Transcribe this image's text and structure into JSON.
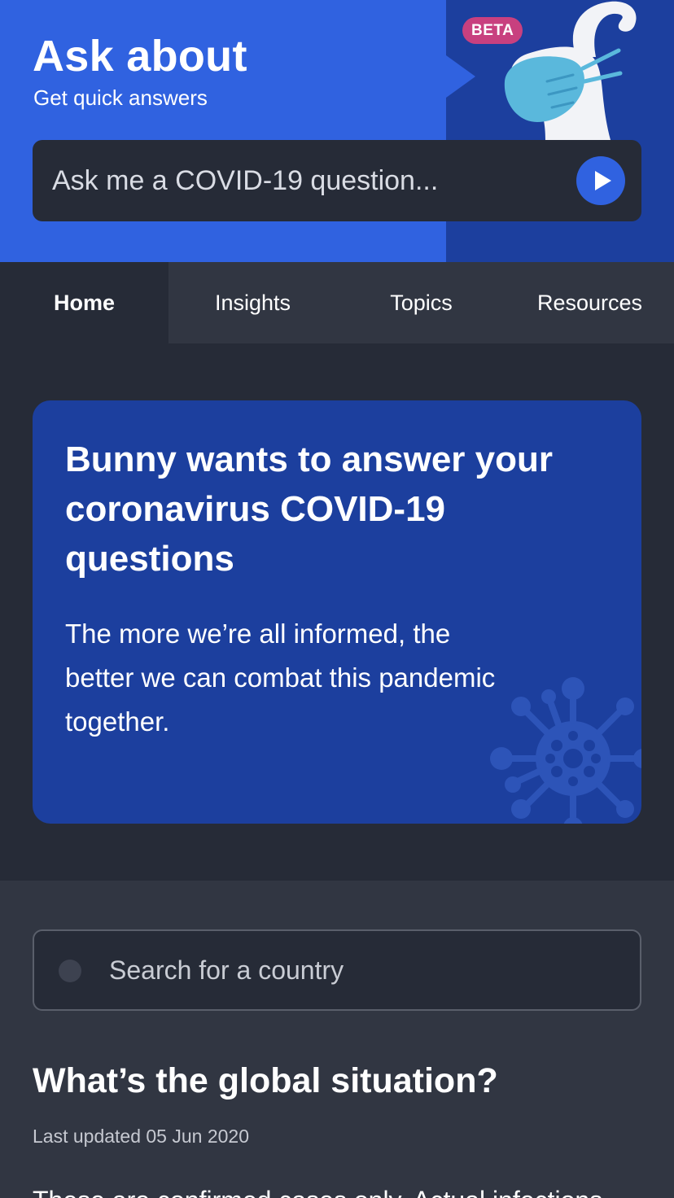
{
  "header": {
    "title": "Ask about",
    "subtitle": "Get quick answers",
    "badge": "BETA",
    "ask_placeholder": "Ask me a COVID-19 question...",
    "mascot_icon": "bunny-with-mask-icon",
    "send_icon": "play-icon"
  },
  "tabs": [
    {
      "label": "Home",
      "active": true
    },
    {
      "label": "Insights",
      "active": false
    },
    {
      "label": "Topics",
      "active": false
    },
    {
      "label": "Resources",
      "active": false
    }
  ],
  "hero": {
    "title": "Bunny wants to answer your coronavirus COVID-19 questions",
    "body": "The more we’re all informed, the better we can combat this pandemic together.",
    "decoration_icon": "virus-icon"
  },
  "search": {
    "placeholder": "Search for a country"
  },
  "global": {
    "title": "What’s the global situation?",
    "updated": "Last updated 05 Jun 2020",
    "note": "These are confirmed cases only. Actual infections"
  },
  "colors": {
    "header_blue": "#3062e0",
    "header_dark_blue": "#1c3f9e",
    "background": "#262b37",
    "panel": "#313642",
    "beta_pink": "#c8407f",
    "mask_cyan": "#5ab8dc"
  }
}
